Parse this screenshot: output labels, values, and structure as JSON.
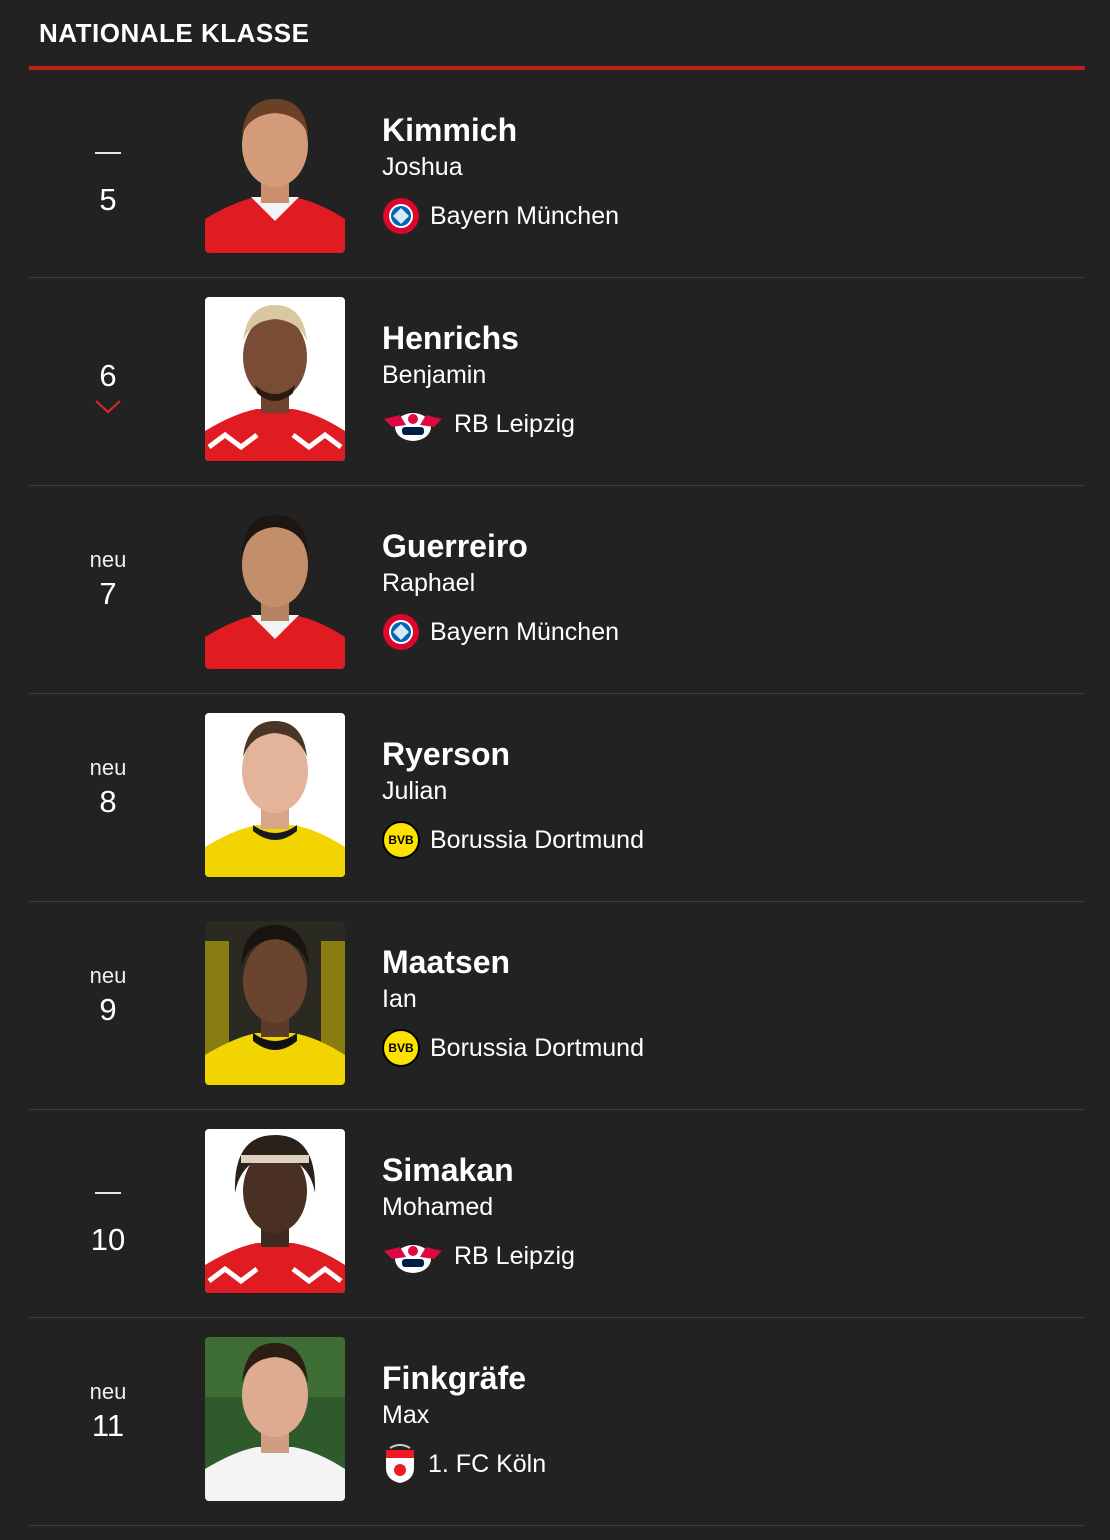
{
  "header": {
    "title": "NATIONALE KLASSE"
  },
  "players": [
    {
      "trend": "",
      "trend_type": "same",
      "rank": "5",
      "surname": "Kimmich",
      "firstname": "Joshua",
      "club": "Bayern München",
      "club_logo": "bayern-logo",
      "photo_bg": "#222222",
      "kit": "#e11b22"
    },
    {
      "trend": "",
      "trend_type": "down",
      "rank": "6",
      "surname": "Henrichs",
      "firstname": "Benjamin",
      "club": "RB Leipzig",
      "club_logo": "rb-leipzig-logo",
      "photo_bg": "#ffffff",
      "kit": "#e11b22"
    },
    {
      "trend": "neu",
      "trend_type": "new",
      "rank": "7",
      "surname": "Guerreiro",
      "firstname": "Raphael",
      "club": "Bayern München",
      "club_logo": "bayern-logo",
      "photo_bg": "#222222",
      "kit": "#e11b22"
    },
    {
      "trend": "neu",
      "trend_type": "new",
      "rank": "8",
      "surname": "Ryerson",
      "firstname": "Julian",
      "club": "Borussia Dortmund",
      "club_logo": "bvb-logo",
      "photo_bg": "#ffffff",
      "kit": "#f2d500"
    },
    {
      "trend": "neu",
      "trend_type": "new",
      "rank": "9",
      "surname": "Maatsen",
      "firstname": "Ian",
      "club": "Borussia Dortmund",
      "club_logo": "bvb-logo",
      "photo_bg": "#e8d000",
      "kit": "#f2d500"
    },
    {
      "trend": "",
      "trend_type": "same",
      "rank": "10",
      "surname": "Simakan",
      "firstname": "Mohamed",
      "club": "RB Leipzig",
      "club_logo": "rb-leipzig-logo",
      "photo_bg": "#ffffff",
      "kit": "#e11b22"
    },
    {
      "trend": "neu",
      "trend_type": "new",
      "rank": "11",
      "surname": "Finkgräfe",
      "firstname": "Max",
      "club": "1. FC Köln",
      "club_logo": "fc-koeln-logo",
      "photo_bg": "#2f5a2c",
      "kit": "#f4f4f4"
    }
  ],
  "colors": {
    "accent": "#c0201a",
    "background": "#222222",
    "divider": "#3d3d3d"
  }
}
